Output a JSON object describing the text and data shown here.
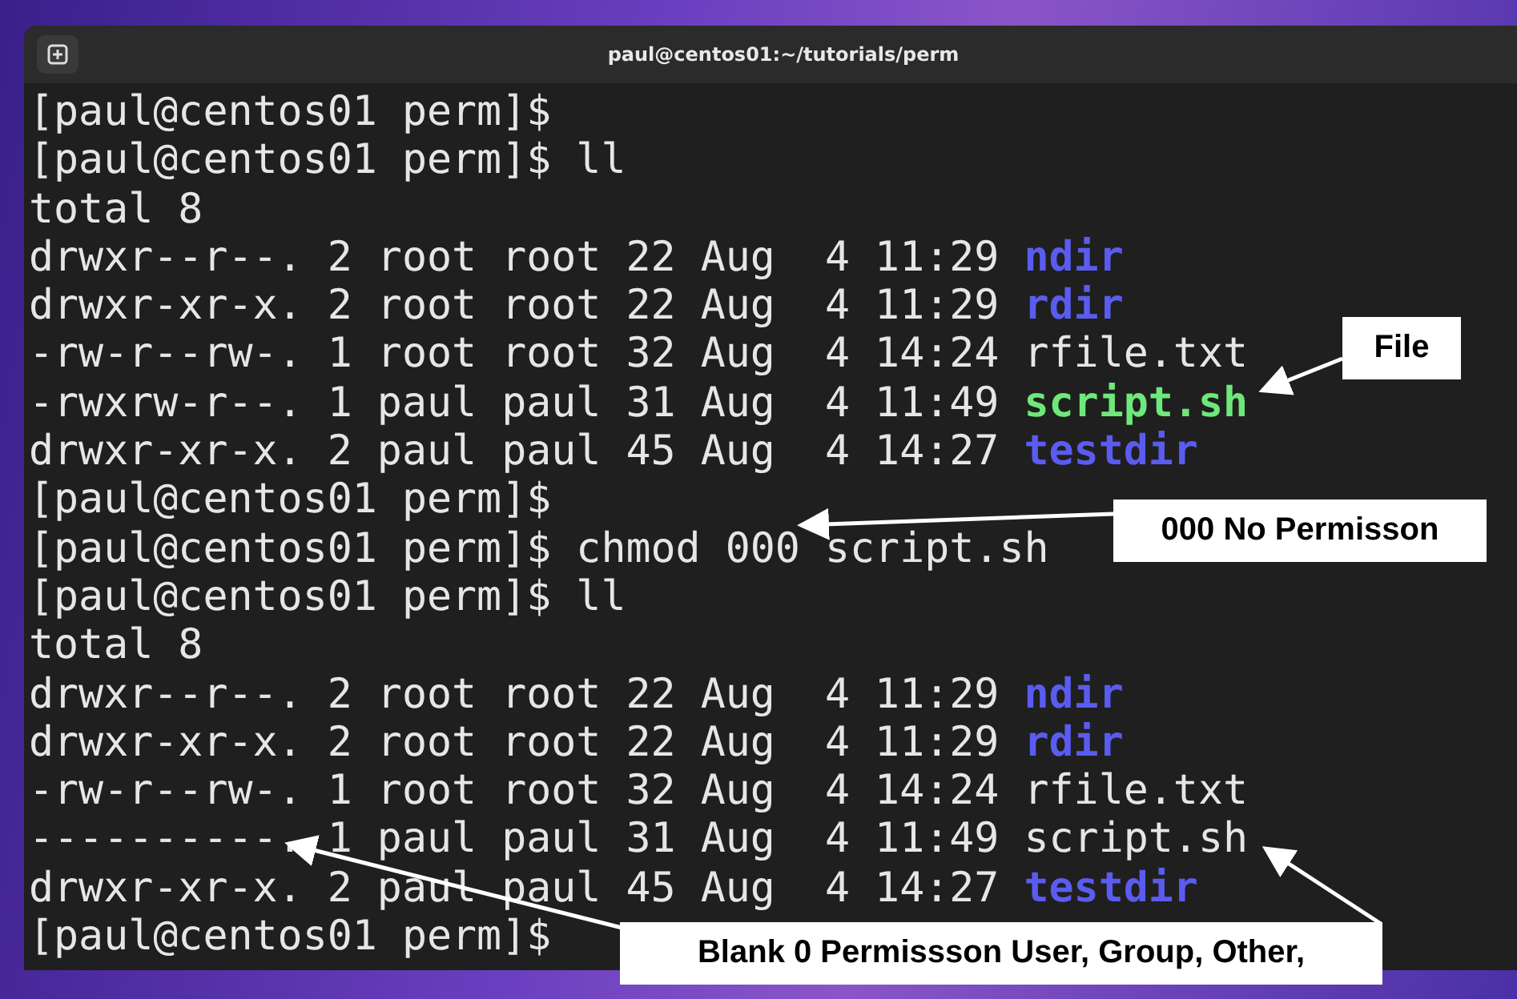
{
  "window": {
    "title": "paul@centos01:~/tutorials/perm"
  },
  "terminal": {
    "lines": [
      {
        "text": "[paul@centos01 perm]$"
      },
      {
        "text": "[paul@centos01 perm]$ ll"
      },
      {
        "text": "total 8"
      },
      {
        "text": "drwxr--r--. 2 root root 22 Aug  4 11:29 ",
        "file": {
          "name": "ndir",
          "kind": "dir"
        }
      },
      {
        "text": "drwxr-xr-x. 2 root root 22 Aug  4 11:29 ",
        "file": {
          "name": "rdir",
          "kind": "dir"
        }
      },
      {
        "text": "-rw-r--rw-. 1 root root 32 Aug  4 14:24 ",
        "file": {
          "name": "rfile.txt",
          "kind": "file"
        }
      },
      {
        "text": "-rwxrw-r--. 1 paul paul 31 Aug  4 11:49 ",
        "file": {
          "name": "script.sh",
          "kind": "exec"
        }
      },
      {
        "text": "drwxr-xr-x. 2 paul paul 45 Aug  4 14:27 ",
        "file": {
          "name": "testdir",
          "kind": "dir"
        }
      },
      {
        "text": "[paul@centos01 perm]$"
      },
      {
        "text": "[paul@centos01 perm]$ chmod 000 script.sh"
      },
      {
        "text": "[paul@centos01 perm]$ ll"
      },
      {
        "text": "total 8"
      },
      {
        "text": "drwxr--r--. 2 root root 22 Aug  4 11:29 ",
        "file": {
          "name": "ndir",
          "kind": "dir"
        }
      },
      {
        "text": "drwxr-xr-x. 2 root root 22 Aug  4 11:29 ",
        "file": {
          "name": "rdir",
          "kind": "dir"
        }
      },
      {
        "text": "-rw-r--rw-. 1 root root 32 Aug  4 14:24 ",
        "file": {
          "name": "rfile.txt",
          "kind": "file"
        }
      },
      {
        "text": "----------. 1 paul paul 31 Aug  4 11:49 ",
        "file": {
          "name": "script.sh",
          "kind": "file"
        }
      },
      {
        "text": "drwxr-xr-x. 2 paul paul 45 Aug  4 14:27 ",
        "file": {
          "name": "testdir",
          "kind": "dir"
        }
      },
      {
        "text": "[paul@centos01 perm]$"
      }
    ]
  },
  "callouts": [
    {
      "text": "File"
    },
    {
      "text": "000 No Permisson"
    },
    {
      "text": "Blank 0 Permissson User, Group, Other,"
    }
  ]
}
